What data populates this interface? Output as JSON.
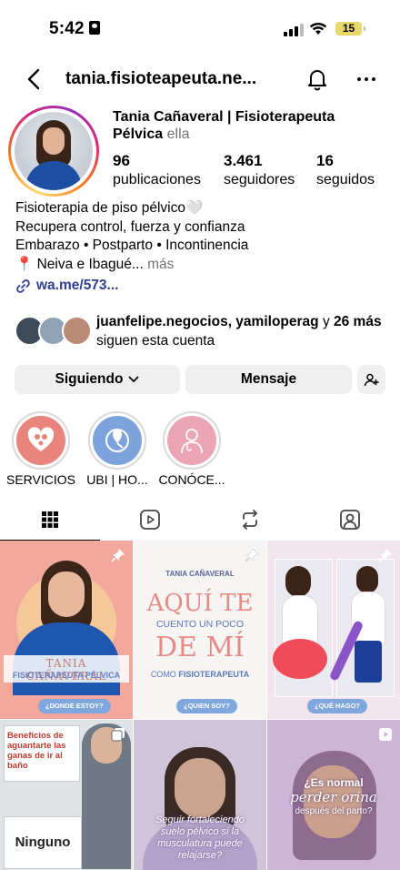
{
  "status_bar": {
    "time": "5:42",
    "battery": "15"
  },
  "nav": {
    "username": "tania.fisioteapeuta.ne..."
  },
  "profile": {
    "name": "Tania Cañaveral | Fisioterapeuta Pélvica",
    "pronoun": "ella",
    "stats": [
      {
        "value": "96",
        "label": "publicaciones"
      },
      {
        "value": "3.461",
        "label": "seguidores"
      },
      {
        "value": "16",
        "label": "seguidos"
      }
    ],
    "bio": [
      "Fisioterapia de piso pélvico🤍",
      "Recupera control, fuerza y confianza",
      "Embarazo • Postparto • Incontinencia",
      "📍 Neiva e Ibagué..."
    ],
    "bio_more": "más",
    "link": "wa.me/573...",
    "followed_by_names": "juanfelipe.negocios, yamiloperag",
    "followed_by_and": "y",
    "followed_by_more": "26 más",
    "followed_by_tail": "siguen esta cuenta"
  },
  "actions": {
    "following": "Siguiendo",
    "message": "Mensaje"
  },
  "highlights": [
    {
      "label": "SERVICIOS",
      "color": "#e8847c"
    },
    {
      "label": "UBI | HO...",
      "color": "#7ca3dc"
    },
    {
      "label": "CONÓCE...",
      "color": "#eba4b4"
    }
  ],
  "tabs": [
    "grid-icon",
    "reels-icon",
    "reposts-icon",
    "tagged-icon"
  ],
  "posts": {
    "p1": {
      "title": "TANIA CAÑAVERAL",
      "subtitle": "FISIOTERAPEUTA PÉLVICA",
      "pill": "¿DONDE ESTOY?"
    },
    "p2": {
      "brand": "TANIA CAÑAVERAL",
      "line1": "AQUÍ TE",
      "line2": "CUENTO UN POCO",
      "line3": "DE MÍ",
      "line4a": "COMO",
      "line4b": "FISIOTERAPEUTA",
      "pill": "¿QUIEN SOY?"
    },
    "p3": {
      "pill": "¿QUÉ HAGO?"
    },
    "p4": {
      "note": "Beneficios de aguantarte las ganas de ir al baño",
      "word": "Ninguno"
    },
    "p5": {
      "caption": "Seguir fortaleciendo suelo pélvico si la musculatura puede relajarse?"
    },
    "p6": {
      "caption1": "¿Es normal",
      "caption2": "perder orina",
      "caption3": "después del parto?"
    }
  }
}
